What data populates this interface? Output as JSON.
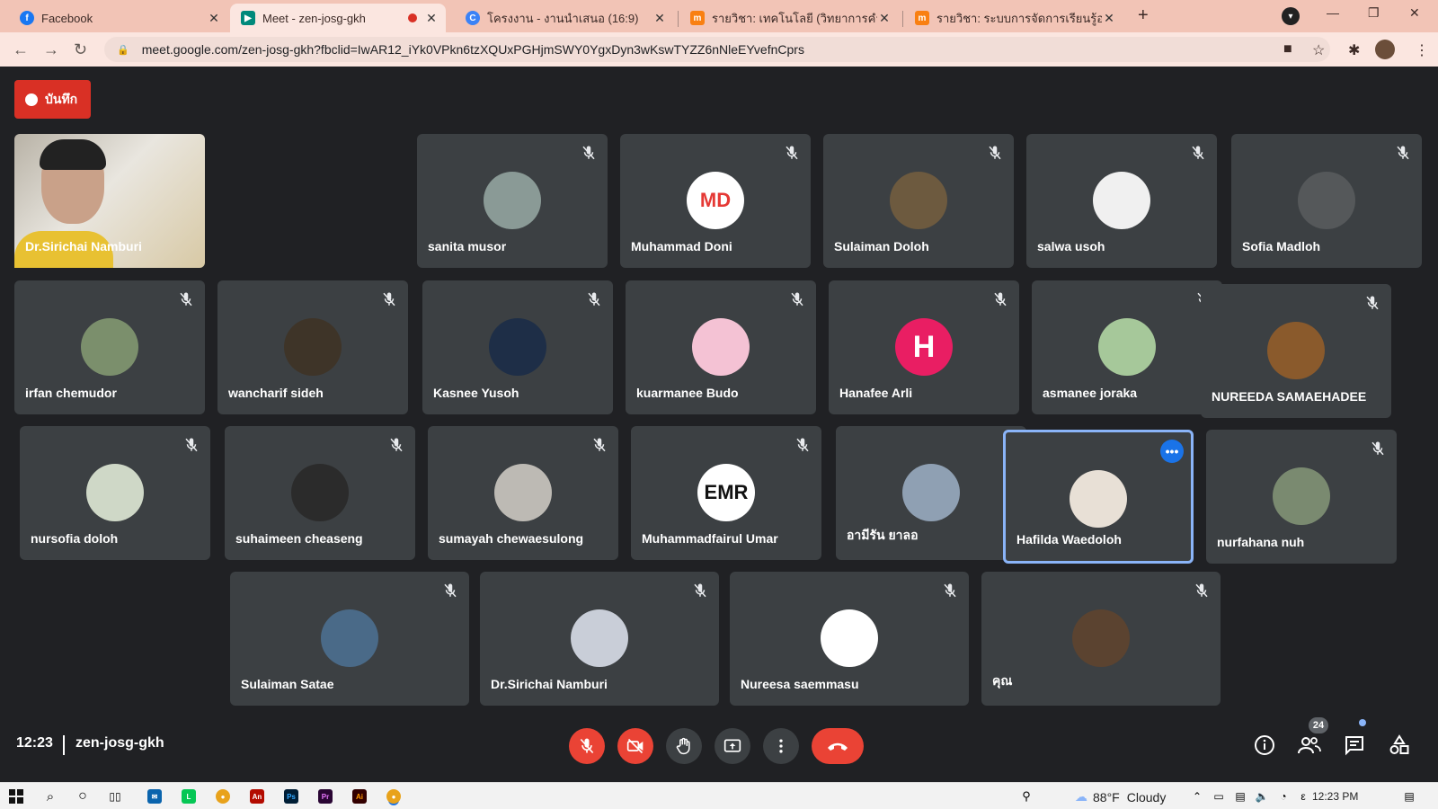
{
  "browser": {
    "tabs": [
      {
        "title": "Facebook",
        "active": false,
        "favicon": "facebook-icon",
        "color": "#1877f2"
      },
      {
        "title": "Meet - zen-josg-gkh",
        "active": true,
        "favicon": "meet-icon",
        "color": "#00897b",
        "recording": true
      },
      {
        "title": "โครงงาน - งานนำเสนอ (16:9)",
        "active": false,
        "favicon": "canva-icon",
        "color": "#3b82f6"
      },
      {
        "title": "รายวิชา: เทคโนโลยี (วิทยาการคำนวณ)",
        "active": false,
        "favicon": "moodle-icon",
        "color": "#f98012"
      },
      {
        "title": "รายวิชา: ระบบการจัดการเรียนรู้ออนไลน์",
        "active": false,
        "favicon": "moodle-icon",
        "color": "#f98012"
      }
    ],
    "url": "meet.google.com/zen-josg-gkh?fbclid=IwAR12_iYk0VPkn6tzXQUxPGHjmSWY0YgxDyn3wKswTYZZ6nNleEYvefnCprs"
  },
  "record_button": {
    "label": "บันทึก"
  },
  "self_tile": {
    "name": "Dr.Sirichai Namburi"
  },
  "participants": [
    {
      "name": "sanita musor",
      "avatar_color": "#8a9a96"
    },
    {
      "name": "Muhammad Doni",
      "avatar_color": "#ffffff",
      "avatar_text": "MD",
      "avatar_text_color": "#e53935"
    },
    {
      "name": "Sulaiman Doloh",
      "avatar_color": "#6d5a3f"
    },
    {
      "name": "salwa usoh",
      "avatar_color": "#f0f0f0"
    },
    {
      "name": "Sofia Madloh",
      "avatar_color": "#55585a"
    },
    {
      "name": "irfan chemudor",
      "avatar_color": "#7b8f6c"
    },
    {
      "name": "wancharif sideh",
      "avatar_color": "#3e3428"
    },
    {
      "name": "Kasnee Yusoh",
      "avatar_color": "#1e2e47"
    },
    {
      "name": "kuarmanee Budo",
      "avatar_color": "#f4c2d4"
    },
    {
      "name": "Hanafee Arli",
      "avatar_color": "#e91e63",
      "avatar_text": "H"
    },
    {
      "name": "asmanee joraka",
      "avatar_color": "#a6c89a"
    },
    {
      "name": "NUREEDA SAMAEHADEE",
      "avatar_color": "#8a5a2c"
    },
    {
      "name": "nursofia doloh",
      "avatar_color": "#cfd8c7"
    },
    {
      "name": "suhaimeen cheaseng",
      "avatar_color": "#2b2b2b"
    },
    {
      "name": "sumayah chewaesulong",
      "avatar_color": "#bdbab4"
    },
    {
      "name": "Muhammadfairul Umar",
      "avatar_color": "#ffffff",
      "avatar_text": "EMR",
      "avatar_text_color": "#111111"
    },
    {
      "name": "อามีรัน ยาลอ",
      "avatar_color": "#8fa0b3"
    },
    {
      "name": "Hafilda Waedoloh",
      "avatar_color": "#e8e0d6",
      "selected": true
    },
    {
      "name": "nurfahana nuh",
      "avatar_color": "#7a8a70"
    },
    {
      "name": "Sulaiman Satae",
      "avatar_color": "#4a6a88"
    },
    {
      "name": "Dr.Sirichai Namburi",
      "avatar_color": "#c9ced8"
    },
    {
      "name": "Nureesa saemmasu",
      "avatar_color": "#ffffff"
    },
    {
      "name": "คุณ",
      "avatar_color": "#5b4330"
    }
  ],
  "meeting": {
    "time": "12:23",
    "code": "zen-josg-gkh",
    "participant_count": "24"
  },
  "taskbar": {
    "temperature": "88°F",
    "condition": "Cloudy",
    "time": "12:23 PM"
  },
  "colors": {
    "accent": "#ea4335",
    "selected_border": "#8ab4f8",
    "background": "#202124",
    "tile": "#3c4043"
  }
}
